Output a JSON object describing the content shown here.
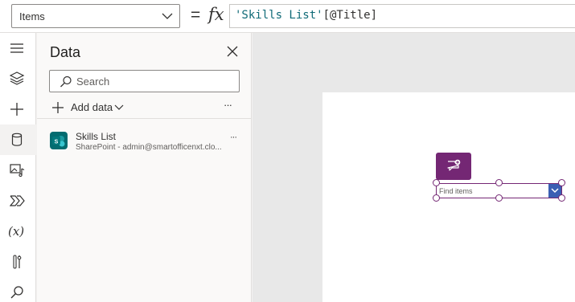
{
  "formula_bar": {
    "property": "Items",
    "equals": "=",
    "fx": "fx",
    "formula_str": "'Skills List'",
    "formula_rest": "[@Title]"
  },
  "rail": {
    "items": [
      {
        "icon": "hamburger-icon"
      },
      {
        "icon": "layers-icon"
      },
      {
        "icon": "plus-icon"
      },
      {
        "icon": "database-icon",
        "active": true
      },
      {
        "icon": "media-icon"
      },
      {
        "icon": "power-automate-icon"
      },
      {
        "icon": "variables-icon",
        "text": "(x)"
      },
      {
        "icon": "tools-icon"
      },
      {
        "icon": "search-icon"
      }
    ]
  },
  "data_pane": {
    "title": "Data",
    "search_placeholder": "Search",
    "add_data_label": "Add data",
    "more": "···",
    "sources": [
      {
        "name": "Skills List",
        "subtitle": "SharePoint - admin@smartofficenxt.clo...",
        "more": "···"
      }
    ]
  },
  "canvas": {
    "combo_placeholder": "Find items"
  },
  "colors": {
    "accent": "#742774",
    "dropdown": "#3b5fb3",
    "sharepoint": "#036c70",
    "formula_string": "#0f6a77"
  }
}
